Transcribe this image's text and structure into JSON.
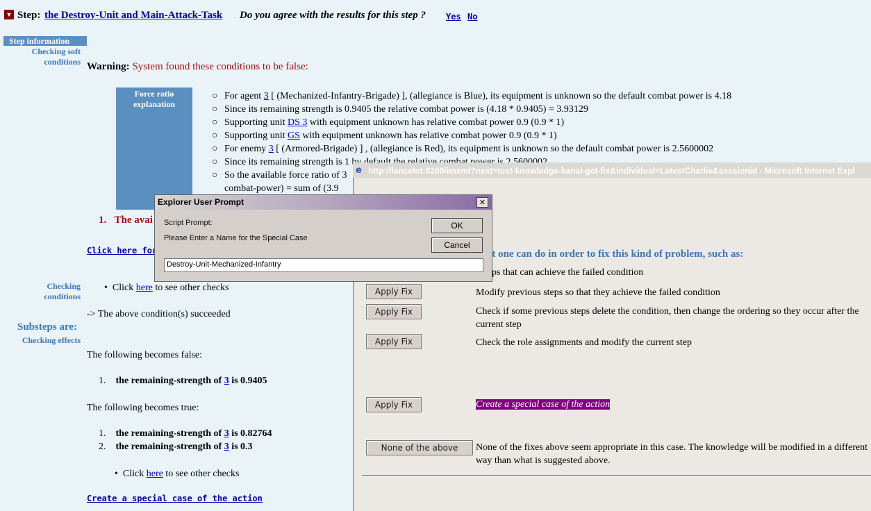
{
  "header": {
    "toggle_glyph": "▼",
    "step_label": "Step:",
    "step_title": "the Destroy-Unit and Main-Attack-Task",
    "agree_question": "Do you agree with the results for this step ?",
    "yes_label": "Yes",
    "no_label": "No"
  },
  "sidebar": {
    "header": "Step information",
    "checking_soft_1": "Checking soft",
    "checking_soft_2": "conditions",
    "checking_cond_1": "Checking",
    "checking_cond_2": "conditions",
    "substeps": "Substeps are:",
    "checking_effects": "Checking effects"
  },
  "warning": {
    "label": "Warning:",
    "text": "System found these conditions to be false:"
  },
  "force_ratio": {
    "box_line1": "Force ratio",
    "box_line2": "explanation",
    "bullets": [
      {
        "pre": "For agent ",
        "link": "3",
        "post": " [ (Mechanized-Infantry-Brigade) ], (allegiance is Blue), its equipment is unknown so the default combat power is 4.18"
      },
      {
        "pre": "Since its remaining strength is 0.9405 the relative combat power is (4.18 * 0.9405) = 3.93129",
        "link": "",
        "post": ""
      },
      {
        "pre": "Supporting unit ",
        "link": "DS 3",
        "post": " with equipment unknown has relative combat power 0.9 (0.9 * 1)"
      },
      {
        "pre": "Supporting unit ",
        "link": "GS",
        "post": " with equipment unknown has relative combat power 0.9 (0.9 * 1)"
      },
      {
        "pre": "For enemy ",
        "link": "3",
        "post": " [ (Armored-Brigade) ] , (allegiance is Red), its equipment is unknown so the default combat power is 2.5600002"
      },
      {
        "pre": "Since its remaining strength is 1 by default the relative combat power is 2.5600002",
        "link": "",
        "post": ""
      },
      {
        "pre": "So the available force ratio of 3",
        "link": "",
        "post": ""
      }
    ],
    "continuation": "combat-power) = sum of (3.9"
  },
  "failed": {
    "number": "1.",
    "text": "The avai"
  },
  "click_here_s": "Click here for s",
  "checks": {
    "click": "Click",
    "here": "here",
    "rest": " to see other checks"
  },
  "succeeded": "-> The above condition(s) succeeded",
  "becomes_false": {
    "heading": "The following becomes false:",
    "items": [
      {
        "num": "1.",
        "pre": "the remaining-strength of ",
        "link": "3",
        "post": " is 0.9405"
      }
    ]
  },
  "becomes_true": {
    "heading": "The following becomes true:",
    "items": [
      {
        "num": "1.",
        "pre": "the remaining-strength of ",
        "link": "3",
        "post": " is 0.82764"
      },
      {
        "num": "2.",
        "pre": "the remaining-strength of ",
        "link": "3",
        "post": " is 0.3"
      }
    ]
  },
  "bottom_link": "Create a special case of the action",
  "browser": {
    "title": "http://lancelot:8200/imxml?next=test-knowledge-kanal-get-fix&individual=LatestCharlie&sessionid - Microsoft Internet Expl",
    "icon_glyph": "e",
    "heading": "nt one can do in order to fix this kind of problem, such as:",
    "fixes": [
      {
        "button": "",
        "desc": "l steps that can achieve the failed condition"
      },
      {
        "button": "Apply Fix",
        "desc": "Modify previous steps so that they achieve the failed condition"
      },
      {
        "button": "Apply Fix",
        "desc": "Check if some previous steps delete the condition, then change the ordering so they occur after the current step"
      },
      {
        "button": "Apply Fix",
        "desc": "Check the role assignments and modify the current step"
      },
      {
        "button": "Apply Fix",
        "desc": "Create a special case of the action"
      },
      {
        "button": "None of the above",
        "desc": "None of the fixes above seem appropriate in this case. The knowledge will be modified in a different way than what is suggested above."
      }
    ]
  },
  "dialog": {
    "title": "Explorer User Prompt",
    "close": "✕",
    "script_prompt": "Script Prompt:",
    "message": "Please Enter a Name for the Special Case",
    "ok": "OK",
    "cancel": "Cancel",
    "value": "Destroy-Unit-Mechanized-Infantry"
  }
}
